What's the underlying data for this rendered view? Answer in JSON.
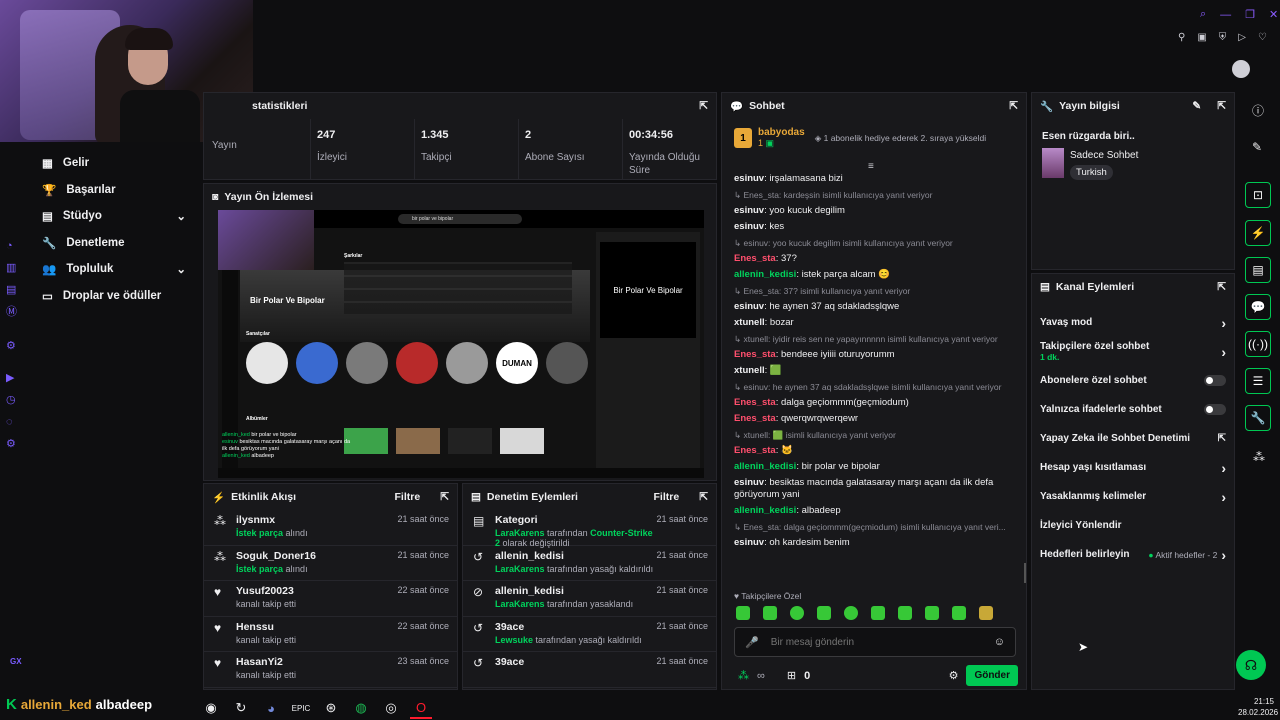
{
  "left_nav": {
    "items": [
      {
        "label": "Gelir",
        "icon": "table-icon"
      },
      {
        "label": "Başarılar",
        "icon": "trophy-icon"
      },
      {
        "label": "Stüdyo",
        "icon": "studio-icon",
        "chevron": true
      },
      {
        "label": "Denetleme",
        "icon": "wrench-icon"
      },
      {
        "label": "Topluluk",
        "icon": "community-icon",
        "chevron": true
      },
      {
        "label": "Droplar ve ödüller",
        "icon": "gift-icon"
      }
    ],
    "bottom_label": "GX"
  },
  "stats_panel": {
    "title": "statistikleri",
    "items": [
      {
        "value": "",
        "label": "Yayın"
      },
      {
        "value": "247",
        "label": "İzleyici"
      },
      {
        "value": "1.345",
        "label": "Takipçi"
      },
      {
        "value": "2",
        "label": "Abone Sayısı"
      },
      {
        "value": "00:34:56",
        "label": "Yayında Olduğu Süre"
      }
    ]
  },
  "preview_panel": {
    "title": "Yayın Ön İzlemesi",
    "album_title": "Bir Polar Ve Bipolar",
    "songs_heading": "Şarkılar",
    "artists_heading": "Sanatçılar",
    "albums_heading": "Albümler",
    "artist_badge": "DUMAN",
    "side_card_title": "Bir Polar Ve Bipolar",
    "search_text": "bir polar ve bipolar",
    "overlay_chat": [
      {
        "user": "allenin_ked",
        "text": "bir polar ve bipolar"
      },
      {
        "user": "esinuv",
        "text": "besiktas macında galatasaray marşı açanı da ilk defa görüyorum yani"
      },
      {
        "user": "allenin_ked",
        "text": "albadeep"
      }
    ]
  },
  "activity_panel": {
    "title": "Etkinlik Akışı",
    "filter_label": "Filtre",
    "items": [
      {
        "user": "ilysnmx",
        "action": "İstek parça",
        "action_rest": "alındı",
        "time": "21 saat önce",
        "icon": "request-icon",
        "highlight": true
      },
      {
        "user": "Soguk_Doner16",
        "action": "İstek parça",
        "action_rest": "alındı",
        "time": "21 saat önce",
        "icon": "request-icon",
        "highlight": true
      },
      {
        "user": "Yusuf20023",
        "action": "kanalı takip etti",
        "action_rest": "",
        "time": "22 saat önce",
        "icon": "heart-icon",
        "highlight": false
      },
      {
        "user": "Henssu",
        "action": "kanalı takip etti",
        "action_rest": "",
        "time": "22 saat önce",
        "icon": "heart-icon",
        "highlight": false
      },
      {
        "user": "HasanYi2",
        "action": "kanalı takip etti",
        "action_rest": "",
        "time": "23 saat önce",
        "icon": "heart-icon",
        "highlight": false
      }
    ]
  },
  "mod_actions_panel": {
    "title": "Denetim Eylemleri",
    "filter_label": "Filtre",
    "items": [
      {
        "title": "Kategori",
        "mod": "LaraKarens",
        "mid": "tarafından",
        "target": "Counter-Strike 2",
        "rest": "olarak değiştirildi",
        "time": "21 saat önce",
        "icon": "category-icon"
      },
      {
        "title": "allenin_kedisi",
        "mod": "LaraKarens",
        "mid": "tarafından yasağı kaldırıldı",
        "target": "",
        "rest": "",
        "time": "21 saat önce",
        "icon": "undo-icon"
      },
      {
        "title": "allenin_kedisi",
        "mod": "LaraKarens",
        "mid": "tarafından yasaklandı",
        "target": "",
        "rest": "",
        "time": "21 saat önce",
        "icon": "ban-icon"
      },
      {
        "title": "39ace",
        "mod": "Lewsuke",
        "mid": "tarafından yasağı kaldırıldı",
        "target": "",
        "rest": "",
        "time": "21 saat önce",
        "icon": "undo-icon"
      },
      {
        "title": "39ace",
        "mod": "",
        "mid": "",
        "target": "",
        "rest": "",
        "time": "21 saat önce",
        "icon": "undo-icon"
      }
    ]
  },
  "chat_panel": {
    "title": "Sohbet",
    "pinned_user": "babyodas",
    "pinned_badge_count": "1",
    "pinned_text": "1 abonelik hediye ederek 2. sıraya yükseldi",
    "messages": [
      {
        "type": "msg",
        "user": "esinuv",
        "text": "irşalamasana bizi",
        "color": "#efeff1"
      },
      {
        "type": "reply",
        "text": "Enes_sta: kardeşsin isimli kullanıcıya yanıt veriyor"
      },
      {
        "type": "msg",
        "user": "esinuv",
        "text": "yoo kucuk degilim",
        "color": "#efeff1"
      },
      {
        "type": "msg",
        "user": "esinuv",
        "text": "kes",
        "color": "#efeff1"
      },
      {
        "type": "reply",
        "text": "esinuv: yoo kucuk degilim isimli kullanıcıya yanıt veriyor"
      },
      {
        "type": "msg",
        "user": "Enes_sta",
        "text": "37?",
        "color": "#ff4f6d"
      },
      {
        "type": "msg",
        "user": "allenin_kedisi",
        "text": "istek parça alcam 😊",
        "color": "#00d35c"
      },
      {
        "type": "reply",
        "text": "Enes_sta: 37? isimli kullanıcıya yanıt veriyor"
      },
      {
        "type": "msg",
        "user": "esinuv",
        "text": "he aynen 37 aq sdakladsşlqwe",
        "color": "#efeff1"
      },
      {
        "type": "msg",
        "user": "xtunell",
        "text": "bozar",
        "color": "#efeff1"
      },
      {
        "type": "reply",
        "text": "xtunell: iyidir reis sen ne yapayınnnnn isimli kullanıcıya yanıt veriyor"
      },
      {
        "type": "msg",
        "user": "Enes_sta",
        "text": "bendeee iyiiii oturuyorumm",
        "color": "#ff4f6d"
      },
      {
        "type": "msg",
        "user": "xtunell",
        "text": "🟩",
        "color": "#efeff1"
      },
      {
        "type": "reply",
        "text": "esinuv: he aynen 37 aq sdakladsşlqwe isimli kullanıcıya yanıt veriyor"
      },
      {
        "type": "msg",
        "user": "Enes_sta",
        "text": "dalga geçiommm(geçmiodum)",
        "color": "#ff4f6d"
      },
      {
        "type": "msg",
        "user": "Enes_sta",
        "text": "qwerqwrqwerqewr",
        "color": "#ff4f6d"
      },
      {
        "type": "reply",
        "text": "xtunell: 🟩 isimli kullanıcıya yanıt veriyor"
      },
      {
        "type": "msg",
        "user": "Enes_sta",
        "text": "🐱",
        "color": "#ff4f6d"
      },
      {
        "type": "msg",
        "user": "allenin_kedisi",
        "text": "bir polar ve bipolar",
        "color": "#00d35c"
      },
      {
        "type": "msg",
        "user": "esinuv",
        "text": "besiktas macında galatasaray marşı açanı da ilk defa görüyorum yani",
        "color": "#efeff1"
      },
      {
        "type": "msg",
        "user": "allenin_kedisi",
        "text": "albadeep",
        "color": "#00d35c"
      },
      {
        "type": "reply",
        "text": "Enes_sta: dalga geçiommm(geçmiodum) isimli kullanıcıya yanıt veri..."
      },
      {
        "type": "msg",
        "user": "esinuv",
        "text": "oh kardesim benim",
        "color": "#efeff1"
      }
    ],
    "emote_section": "Takipçilere Özel",
    "input_placeholder": "Bir mesaj gönderin",
    "points_label": "∞",
    "gift_count": "0",
    "send_label": "Gönder"
  },
  "stream_info_panel": {
    "title": "Yayın bilgisi",
    "stream_title": "Esen rüzgarda biri..",
    "category": "Sadece Sohbet",
    "tag": "Turkish"
  },
  "channel_actions_panel": {
    "title": "Kanal Eylemleri",
    "items": [
      {
        "label": "Yavaş mod",
        "control": "chevron",
        "sub": ""
      },
      {
        "label": "Takipçilere özel sohbet",
        "control": "chevron",
        "sub": "1 dk."
      },
      {
        "label": "Abonelere özel sohbet",
        "control": "toggle",
        "sub": ""
      },
      {
        "label": "Yalnızca ifadelerle sohbet",
        "control": "toggle",
        "sub": ""
      },
      {
        "label": "Yapay Zeka ile Sohbet Denetimi",
        "control": "external",
        "sub": ""
      },
      {
        "label": "Hesap yaşı kısıtlaması",
        "control": "chevron",
        "sub": ""
      },
      {
        "label": "Yasaklanmış kelimeler",
        "control": "chevron",
        "sub": ""
      },
      {
        "label": "İzleyici Yönlendir",
        "control": "none",
        "sub": ""
      },
      {
        "label": "Hedefleri belirleyin",
        "control": "goals",
        "sub": ""
      }
    ],
    "goals_text": "Aktif hedefler - 2"
  },
  "overlay": {
    "bottom_user": "allenin_ked",
    "bottom_text": "albadeep"
  },
  "taskbar": {
    "time": "21:15",
    "date": "28.02.2026",
    "icons": [
      "obs-icon",
      "chevron-icon",
      "discord-icon",
      "epic-icon",
      "steam-icon",
      "spotify-icon",
      "github-icon",
      "opera-icon"
    ]
  },
  "colors": {
    "accent": "#00c853",
    "bg": "#0e0e10",
    "panel": "#18181b"
  }
}
